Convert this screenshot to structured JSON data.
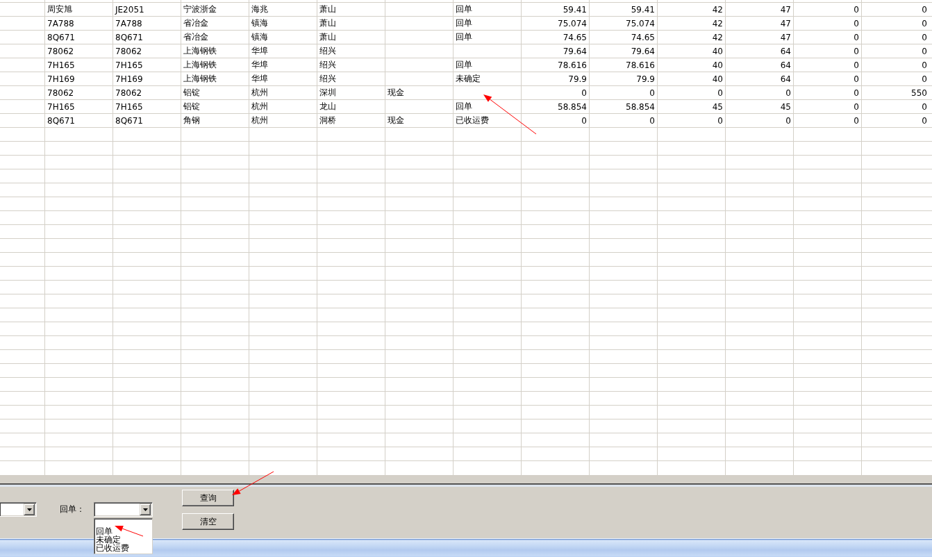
{
  "table": {
    "rows": [
      {
        "column_2": "周安旭",
        "column_3": "JE2051",
        "column_4": "宁波浙金",
        "column_5": "海兆",
        "column_6": "萧山",
        "column_8": "回单",
        "column_9": "59.41",
        "column_10": "59.41",
        "column_11": "42",
        "column_12": "47",
        "column_13": "0",
        "column_14": "0"
      },
      {
        "column_2": "7A788",
        "column_3": "7A788",
        "column_4": "省冶金",
        "column_5": "镇海",
        "column_6": "萧山",
        "column_8": "回单",
        "column_9": "75.074",
        "column_10": "75.074",
        "column_11": "42",
        "column_12": "47",
        "column_13": "0",
        "column_14": "0"
      },
      {
        "column_2": "8Q671",
        "column_3": "8Q671",
        "column_4": "省冶金",
        "column_5": "镇海",
        "column_6": "萧山",
        "column_8": "回单",
        "column_9": "74.65",
        "column_10": "74.65",
        "column_11": "42",
        "column_12": "47",
        "column_13": "0",
        "column_14": "0"
      },
      {
        "column_2": "78062",
        "column_3": "78062",
        "column_4": "上海钢铁",
        "column_5": "华埠",
        "column_6": "绍兴",
        "column_9": "79.64",
        "column_10": "79.64",
        "column_11": "40",
        "column_12": "64",
        "column_13": "0",
        "column_14": "0"
      },
      {
        "column_2": "7H165",
        "column_3": "7H165",
        "column_4": "上海钢铁",
        "column_5": "华埠",
        "column_6": "绍兴",
        "column_8": "回单",
        "column_9": "78.616",
        "column_10": "78.616",
        "column_11": "40",
        "column_12": "64",
        "column_13": "0",
        "column_14": "0"
      },
      {
        "column_2": "7H169",
        "column_3": "7H169",
        "column_4": "上海钢铁",
        "column_5": "华埠",
        "column_6": "绍兴",
        "column_8": "未确定",
        "column_9": "79.9",
        "column_10": "79.9",
        "column_11": "40",
        "column_12": "64",
        "column_13": "0",
        "column_14": "0"
      },
      {
        "column_2": "78062",
        "column_3": "78062",
        "column_4": "铝锭",
        "column_5": "杭州",
        "column_6": "深圳",
        "column_7": "现金",
        "column_9": "0",
        "column_10": "0",
        "column_11": "0",
        "column_12": "0",
        "column_13": "0",
        "column_14": "550"
      },
      {
        "column_2": "7H165",
        "column_3": "7H165",
        "column_4": "铝锭",
        "column_5": "杭州",
        "column_6": "龙山",
        "column_8": "回单",
        "column_9": "58.854",
        "column_10": "58.854",
        "column_11": "45",
        "column_12": "45",
        "column_13": "0",
        "column_14": "0"
      },
      {
        "column_2": "8Q671",
        "column_3": "8Q671",
        "column_4": "角钢",
        "column_5": "杭州",
        "column_6": "洞桥",
        "column_7": "现金",
        "column_8": "已收运费",
        "column_9": "0",
        "column_10": "0",
        "column_11": "0",
        "column_12": "0",
        "column_13": "0",
        "column_14": "0"
      }
    ]
  },
  "filter_panel": {
    "fields": [
      {
        "label": "回单：",
        "options": [
          {
            "label": "回单",
            "selected": false
          },
          {
            "label": "未确定",
            "selected": false
          },
          {
            "label": "已收运费",
            "selected": false
          }
        ]
      }
    ],
    "buttons": [
      {
        "label": "查询"
      },
      {
        "label": "清空"
      }
    ]
  }
}
